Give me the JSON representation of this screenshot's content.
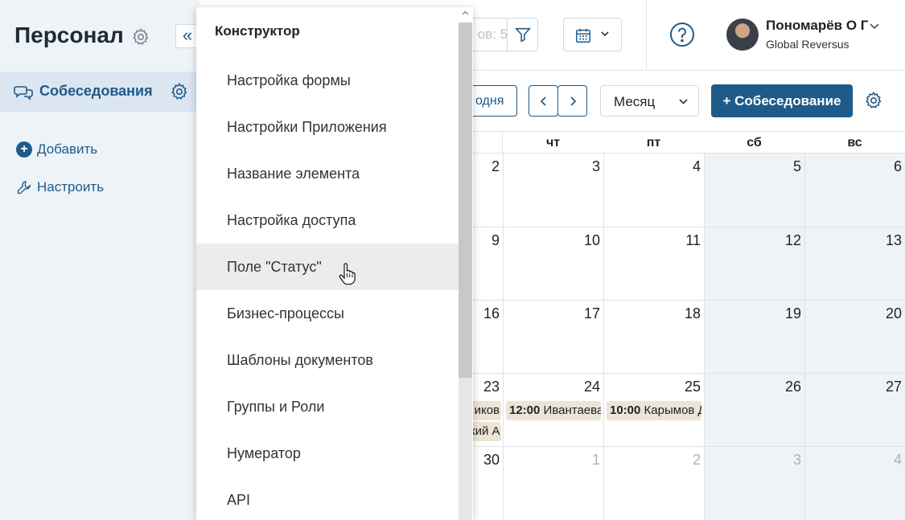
{
  "app": {
    "title": "Персонал"
  },
  "sidebar": {
    "collapse_glyph": "«",
    "nav_active": {
      "label": "Собеседования",
      "icon": "chat-bubbles-icon"
    },
    "links": [
      {
        "label": "Добавить",
        "icon": "plus-circle-icon"
      },
      {
        "label": "Настроить",
        "icon": "wrench-icon"
      }
    ]
  },
  "topbar": {
    "filter_text": "ов: 5",
    "help_icon": "question-circle-icon",
    "user": {
      "name": "Пономарёв О Г",
      "org": "Global Reversus"
    }
  },
  "toolbar": {
    "today_label": "одня",
    "view_select": "Месяц",
    "add_label": "+ Собеседование"
  },
  "calendar": {
    "day_headers": [
      "чт",
      "пт",
      "сб",
      "вс"
    ],
    "weeks": [
      [
        "2",
        "3",
        "4",
        "5",
        "6"
      ],
      [
        "9",
        "10",
        "11",
        "12",
        "13"
      ],
      [
        "16",
        "17",
        "18",
        "19",
        "20"
      ],
      [
        "23",
        "24",
        "25",
        "26",
        "27"
      ],
      [
        "30",
        "1",
        "2",
        "3",
        "4"
      ]
    ],
    "events": {
      "w3_c0_a": "иков",
      "w3_c0_b": "кий А",
      "w3_c1_time": "12:00",
      "w3_c1_name": "Ивантаева",
      "w3_c2_time": "10:00",
      "w3_c2_name": "Карымов Д"
    }
  },
  "menu": {
    "header": "Конструктор",
    "items": [
      "Настройка формы",
      "Настройки Приложения",
      "Название элемента",
      "Настройка доступа",
      "Поле \"Статус\"",
      "Бизнес-процессы",
      "Шаблоны документов",
      "Группы и Роли",
      "Нумератор",
      "API"
    ],
    "hovered_index": 4
  },
  "colors": {
    "accent": "#1e5b8a",
    "sidebar_bg": "#eef3f8",
    "event_bg": "#ece4d6",
    "weekend_bg": "#eef3f8"
  }
}
